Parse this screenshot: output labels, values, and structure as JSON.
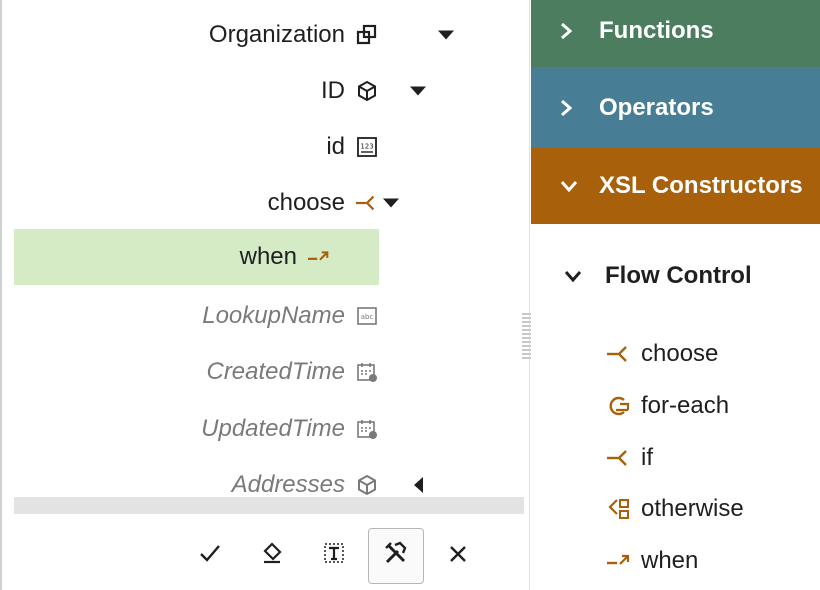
{
  "tree": {
    "rows": [
      {
        "label": "Organization",
        "icon": "collection-icon",
        "caret": "down"
      },
      {
        "label": "ID",
        "icon": "cube-icon",
        "caret": "down"
      },
      {
        "label": "id",
        "icon": "number-icon",
        "caret": ""
      },
      {
        "label": "choose",
        "icon": "choose-icon",
        "caret": "down"
      },
      {
        "label": "when",
        "icon": "when-icon",
        "caret": "",
        "selected": true
      },
      {
        "label": "LookupName",
        "icon": "string-icon",
        "caret": "",
        "italic": true
      },
      {
        "label": "CreatedTime",
        "icon": "datetime-icon",
        "caret": "",
        "italic": true
      },
      {
        "label": "UpdatedTime",
        "icon": "datetime-icon",
        "caret": "",
        "italic": true
      },
      {
        "label": "Addresses",
        "icon": "cube-icon",
        "caret": "left",
        "italic": true
      }
    ]
  },
  "toolbar": {
    "buttons": [
      {
        "name": "apply-check-icon",
        "glyph": "✓"
      },
      {
        "name": "eraser-icon",
        "glyph": "◈"
      },
      {
        "name": "text-frame-icon",
        "glyph": "T"
      },
      {
        "name": "tools-icon",
        "glyph": "⚒"
      },
      {
        "name": "close-icon",
        "glyph": "✕"
      }
    ]
  },
  "palette": {
    "sections": [
      {
        "label": "Functions",
        "expanded": false,
        "color": "#4c7d5f"
      },
      {
        "label": "Operators",
        "expanded": false,
        "color": "#477e95"
      },
      {
        "label": "XSL Constructors",
        "expanded": true,
        "color": "#a8600b"
      }
    ],
    "subsection": {
      "label": "Flow Control",
      "expanded": true
    },
    "items": [
      {
        "label": "choose",
        "icon": "choose-icon"
      },
      {
        "label": "for-each",
        "icon": "for-each-icon"
      },
      {
        "label": "if",
        "icon": "if-icon"
      },
      {
        "label": "otherwise",
        "icon": "otherwise-icon"
      },
      {
        "label": "when",
        "icon": "when-icon"
      }
    ]
  },
  "colors": {
    "selected_row": "#d4ebc6",
    "icon_accent": "#a8600b"
  }
}
